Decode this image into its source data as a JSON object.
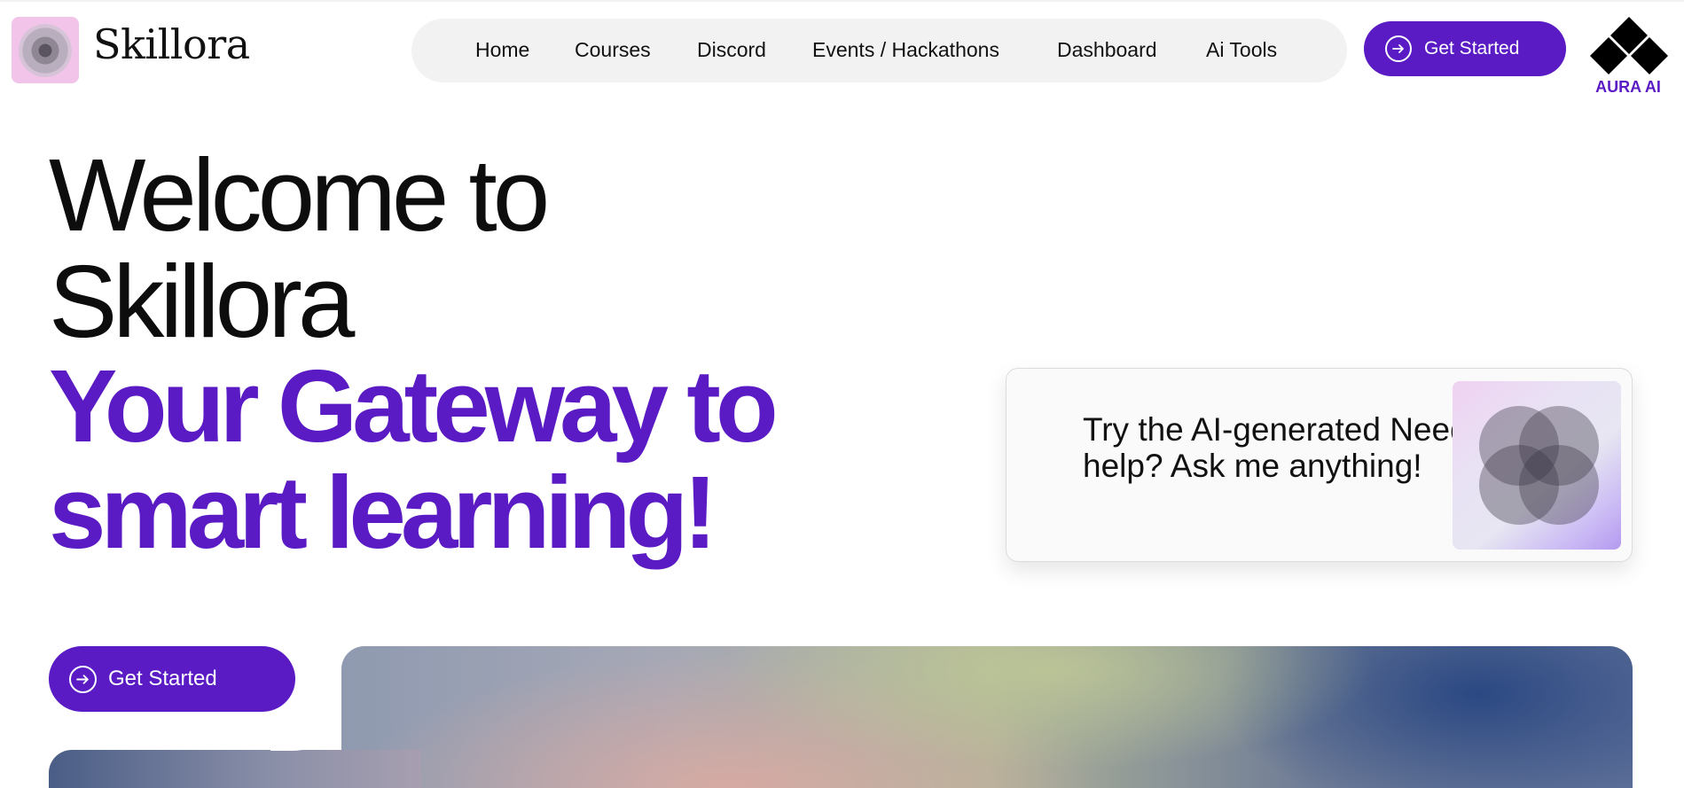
{
  "header": {
    "brand_name": "Skillora",
    "nav_items": [
      "Home",
      "Courses",
      "Discord",
      "Events / Hackathons",
      "Dashboard",
      "Ai Tools"
    ],
    "cta_label": "Get Started",
    "aura_label": "AURA AI"
  },
  "hero": {
    "line1": "Welcome to",
    "line2": "Skillora",
    "line3": "Your Gateway to",
    "line4": "smart learning!",
    "cta_label": "Get Started"
  },
  "ai_card": {
    "text": "Try the AI-generated Need help? Ask me anything!"
  },
  "colors": {
    "accent": "#5a1bc4",
    "nav_bg": "#f2f2f2"
  },
  "icons": {
    "logo": "concentric-circles-icon",
    "cta": "arrow-right-circle-icon",
    "aura": "diamonds-icon",
    "card": "overlapping-circles-icon"
  }
}
